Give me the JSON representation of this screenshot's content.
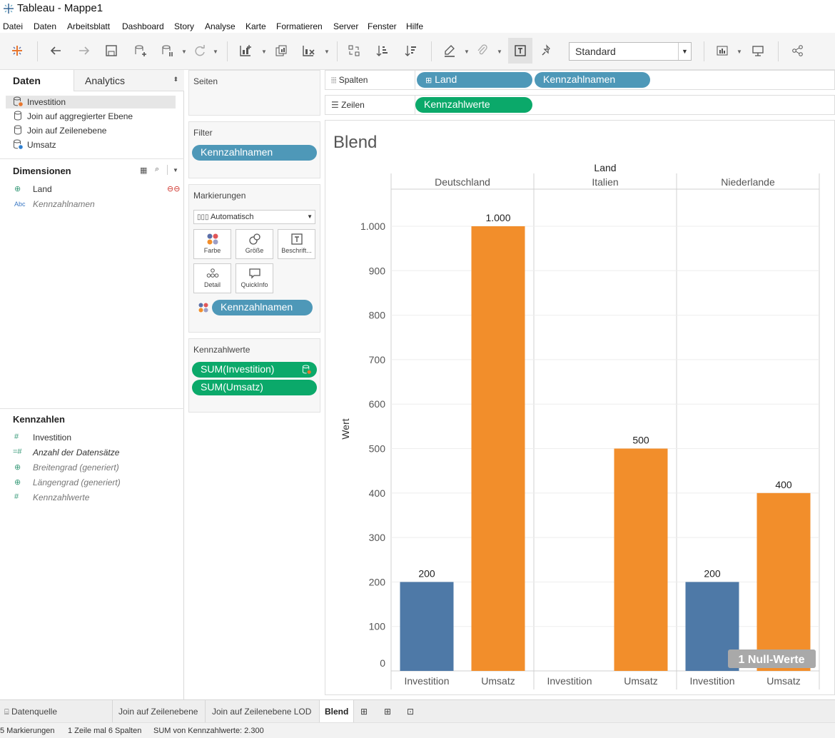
{
  "window": {
    "title": "Tableau - Mappe1"
  },
  "menu": [
    "Datei",
    "Daten",
    "Arbeitsblatt",
    "Dashboard",
    "Story",
    "Analyse",
    "Karte",
    "Formatieren",
    "Server",
    "Fenster",
    "Hilfe"
  ],
  "toolbar": {
    "label_mode": "Standard"
  },
  "datapane": {
    "tabs": [
      "Daten",
      "Analytics"
    ],
    "datasources": [
      "Investition",
      "Join auf aggregierter Ebene",
      "Join auf Zeilenebene",
      "Umsatz"
    ],
    "dimensions_title": "Dimensionen",
    "dimensions": [
      {
        "icon": "globe-icon",
        "type": "⊕",
        "label": "Land"
      },
      {
        "icon": "abc-icon",
        "type": "Abc",
        "label": "Kennzahlnamen"
      }
    ],
    "measures_title": "Kennzahlen",
    "measures": [
      {
        "type": "#",
        "label": "Investition"
      },
      {
        "type": "=#",
        "label": "Anzahl der Datensätze"
      },
      {
        "type": "⊕",
        "label": "Breitengrad (generiert)"
      },
      {
        "type": "⊕",
        "label": "Längengrad (generiert)"
      },
      {
        "type": "#",
        "label": "Kennzahlwerte"
      }
    ]
  },
  "cards": {
    "pages_title": "Seiten",
    "filter_title": "Filter",
    "filter_pill": "Kennzahlnamen",
    "marks_title": "Markierungen",
    "mark_type": "Automatisch",
    "mark_buttons": [
      "Farbe",
      "Größe",
      "Beschrift...",
      "Detail",
      "QuickInfo"
    ],
    "color_pill": "Kennzahlnamen",
    "values_title": "Kennzahlwerte",
    "value_pills": [
      "SUM(Investition)",
      "SUM(Umsatz)"
    ]
  },
  "shelves": {
    "columns_label": "Spalten",
    "columns_pills": [
      "Land",
      "Kennzahlnamen"
    ],
    "rows_label": "Zeilen",
    "rows_pills": [
      "Kennzahlwerte"
    ]
  },
  "view": {
    "title": "Blend",
    "null_badge": "1 Null-Werte"
  },
  "chart_data": {
    "type": "bar",
    "title": "Blend",
    "header_label": "Land",
    "ylabel": "Wert",
    "ylim": [
      0,
      1000
    ],
    "yticks": [
      "0",
      "100",
      "200",
      "300",
      "400",
      "500",
      "600",
      "700",
      "800",
      "900",
      "1.000"
    ],
    "panels": [
      "Deutschland",
      "Italien",
      "Niederlande"
    ],
    "categories": [
      "Investition",
      "Umsatz"
    ],
    "series": [
      {
        "name": "Investition",
        "color": "#4e79a7",
        "values": [
          200,
          null,
          200
        ],
        "labels": [
          "200",
          "",
          "200"
        ]
      },
      {
        "name": "Umsatz",
        "color": "#f28e2b",
        "values": [
          1000,
          500,
          400
        ],
        "labels": [
          "1.000",
          "500",
          "400"
        ]
      }
    ],
    "grid": true
  },
  "sheets": [
    "Datenquelle",
    "Join auf Zeilenebene",
    "Join auf Zeilenebene LOD",
    "Blend"
  ],
  "status": {
    "marks": "5 Markierungen",
    "dims": "1 Zeile mal 6 Spalten",
    "sum": "SUM von Kennzahlwerte: 2.300"
  }
}
